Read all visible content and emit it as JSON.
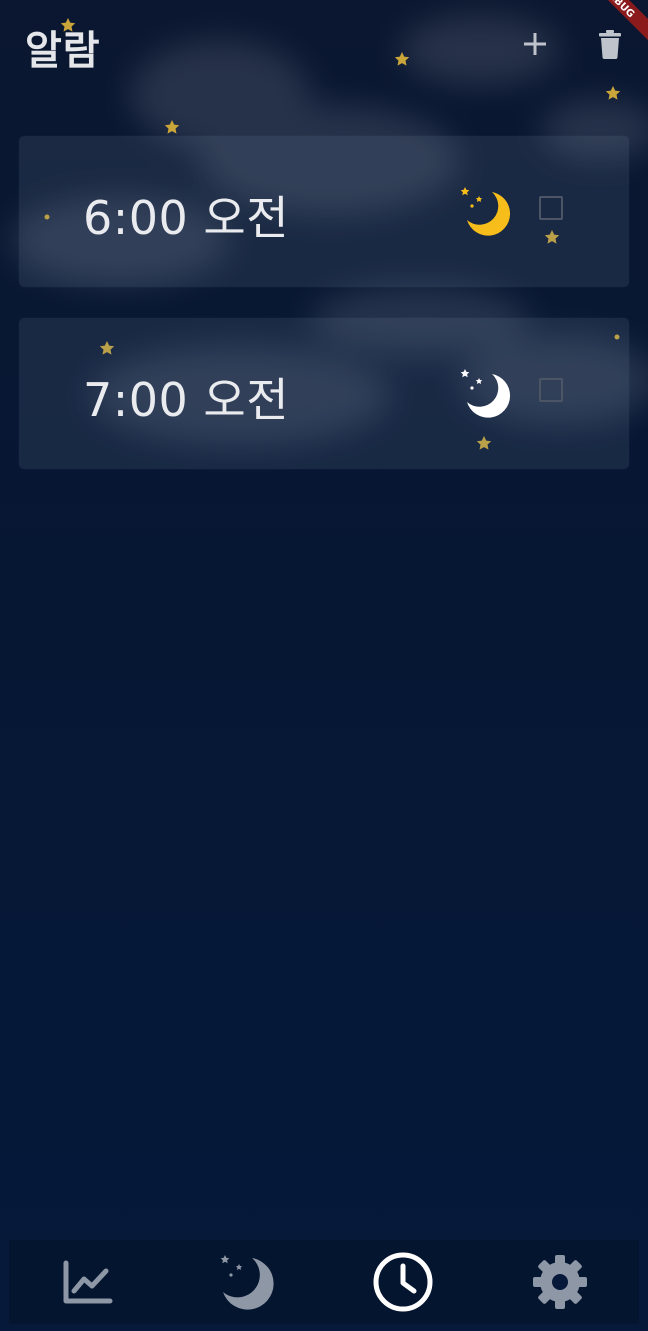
{
  "app_bar": {
    "title": "알람",
    "add_icon": "plus-icon",
    "delete_icon": "trash-icon",
    "debug_banner": "DEBUG"
  },
  "alarms": [
    {
      "time": "6:00 오전",
      "icon": "moon-stars-icon",
      "icon_color": "#f7bd1a",
      "checked": false
    },
    {
      "time": "7:00 오전",
      "icon": "moon-stars-icon",
      "icon_color": "#ffffff",
      "checked": false
    }
  ],
  "bottom_nav": {
    "items": [
      {
        "icon": "chart-line-icon",
        "active": false
      },
      {
        "icon": "moon-stars-icon",
        "active": false
      },
      {
        "icon": "clock-icon",
        "active": true
      },
      {
        "icon": "gear-icon",
        "active": false
      }
    ]
  },
  "colors": {
    "background": "#06193a",
    "star": "#c9a53a",
    "moon_active": "#f7bd1a",
    "nav_active": "#ffffff",
    "nav_inactive": "#8e97a5"
  }
}
